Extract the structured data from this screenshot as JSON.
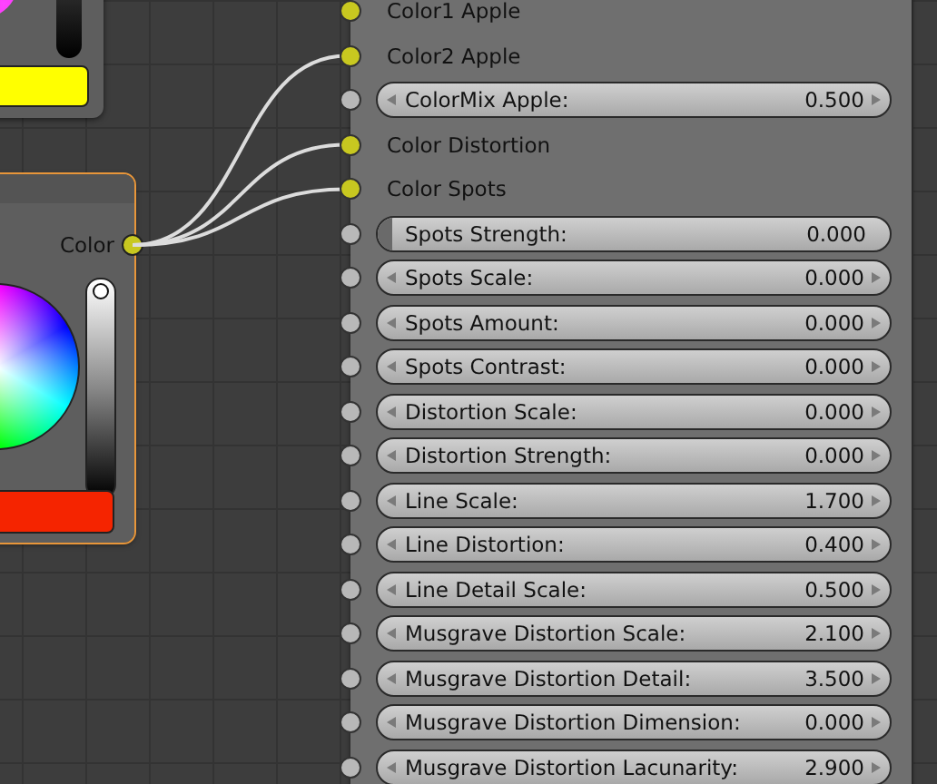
{
  "color_nodes": [
    {
      "kind": "picker_top",
      "selected": false,
      "color": "#ffff00"
    },
    {
      "kind": "picker",
      "selected": true,
      "color": "#f52400",
      "output": "Color",
      "level": 1
    }
  ],
  "texture_node": {
    "inputs": [
      {
        "kind": "color",
        "label": "Color1 Apple",
        "linked": false
      },
      {
        "kind": "color",
        "label": "Color2 Apple",
        "linked": true
      },
      {
        "kind": "number",
        "label": "ColorMix Apple:",
        "value": "0.500"
      },
      {
        "kind": "color",
        "label": "Color Distortion",
        "linked": true
      },
      {
        "kind": "color",
        "label": "Color Spots",
        "linked": true
      },
      {
        "kind": "slider",
        "label": "Spots Strength:",
        "value": "0.000",
        "level": 0
      },
      {
        "kind": "number",
        "label": "Spots Scale:",
        "value": "0.000"
      },
      {
        "kind": "number",
        "label": "Spots Amount:",
        "value": "0.000"
      },
      {
        "kind": "number",
        "label": "Spots Contrast:",
        "value": "0.000"
      },
      {
        "kind": "number",
        "label": "Distortion Scale:",
        "value": "0.000"
      },
      {
        "kind": "number",
        "label": "Distortion Strength:",
        "value": "0.000"
      },
      {
        "kind": "number",
        "label": "Line Scale:",
        "value": "1.700"
      },
      {
        "kind": "number",
        "label": "Line Distortion:",
        "value": "0.400"
      },
      {
        "kind": "number",
        "label": "Line Detail Scale:",
        "value": "0.500"
      },
      {
        "kind": "number",
        "label": "Musgrave Distortion Scale:",
        "value": "2.100"
      },
      {
        "kind": "number",
        "label": "Musgrave Distortion Detail:",
        "value": "3.500"
      },
      {
        "kind": "number",
        "label": "Musgrave Distortion Dimension:",
        "value": "0.000"
      },
      {
        "kind": "number",
        "label": "Musgrave Distortion Lacunarity:",
        "value": "2.900"
      }
    ]
  }
}
